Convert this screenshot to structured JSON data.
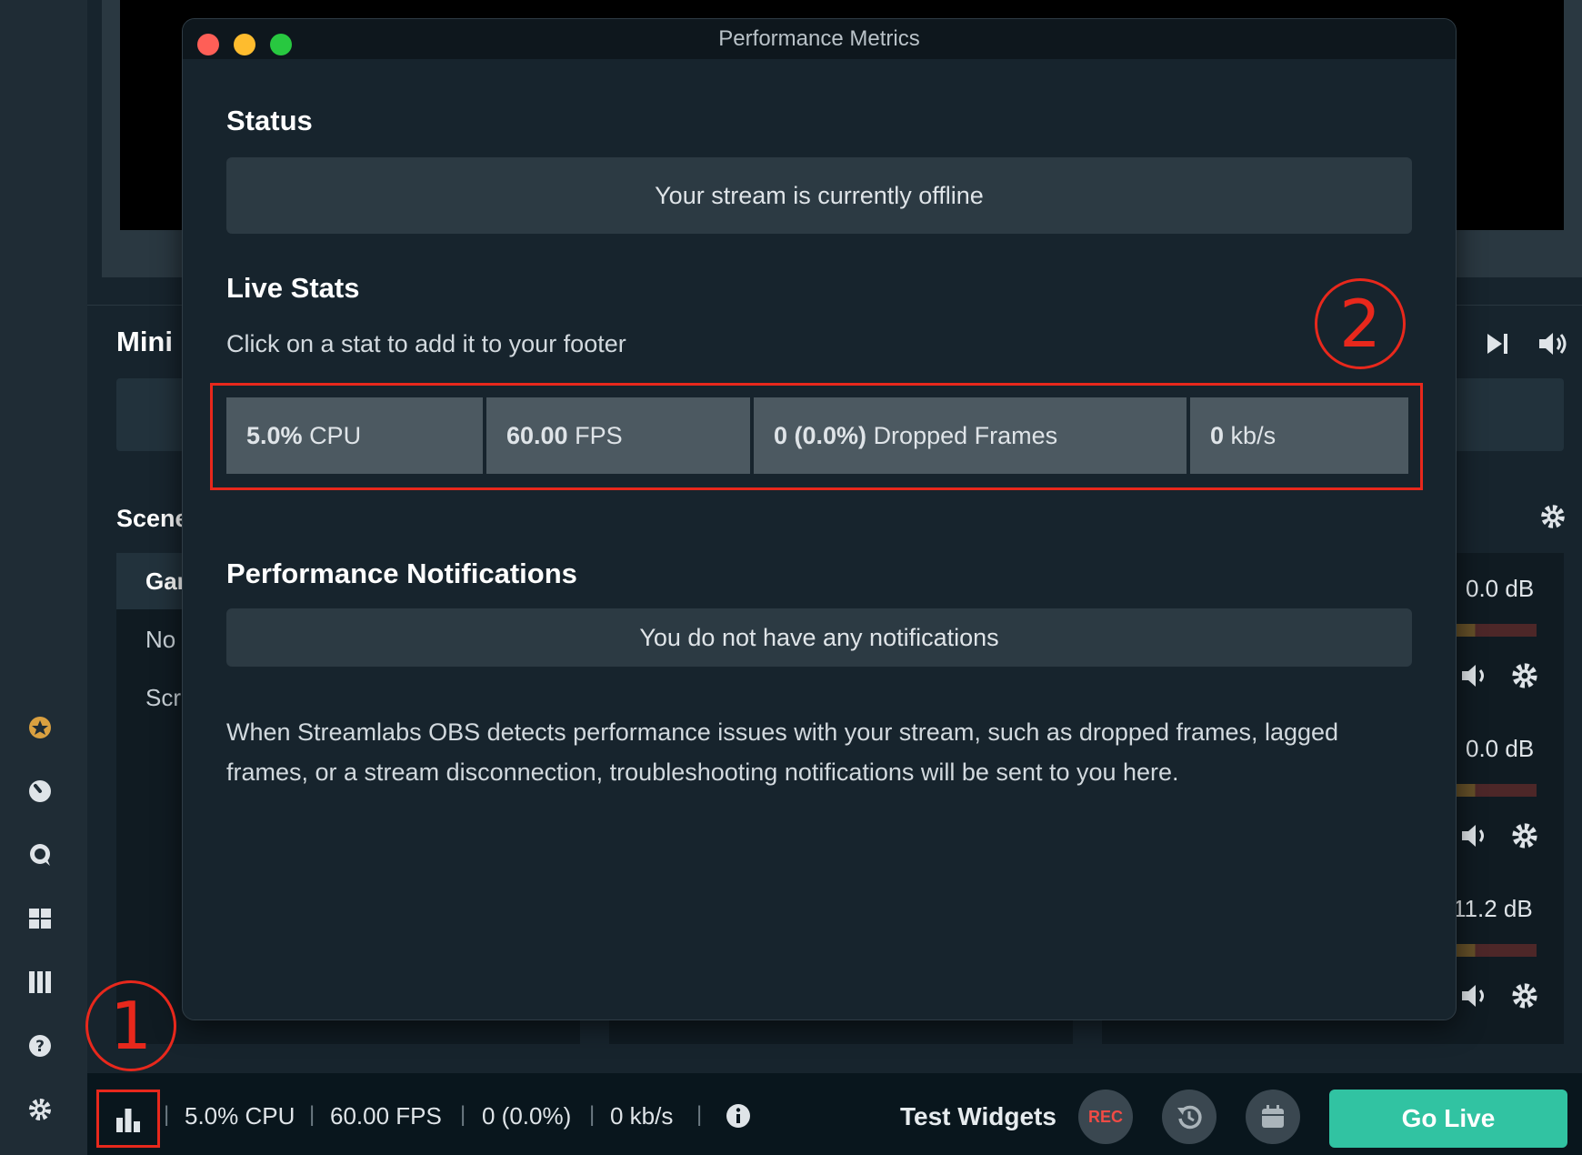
{
  "background": {
    "mini_title": "Mini",
    "scenes_title": "Scene",
    "scene_rows": [
      "Gar",
      "No",
      "Scr"
    ],
    "mixer_db": [
      "0.0 dB",
      "0.0 dB",
      "11.2 dB"
    ]
  },
  "footer": {
    "cpu": "5.0% CPU",
    "fps": "60.00 FPS",
    "dropped": "0 (0.0%)",
    "bitrate": "0 kb/s",
    "separator": "|",
    "test_widgets": "Test Widgets",
    "rec": "REC",
    "go_live": "Go Live"
  },
  "modal": {
    "title": "Performance Metrics",
    "status_title": "Status",
    "status_text": "Your stream is currently offline",
    "live_stats_title": "Live Stats",
    "live_stats_subtitle": "Click on a stat to add it to your footer",
    "stats": [
      {
        "value": "5.0%",
        "label": "CPU"
      },
      {
        "value": "60.00",
        "label": "FPS"
      },
      {
        "value": "0 (0.0%)",
        "label": "Dropped Frames"
      },
      {
        "value": "0",
        "label": "kb/s"
      }
    ],
    "notifications_title": "Performance Notifications",
    "notifications_text": "You do not have any notifications",
    "notifications_desc": "When Streamlabs OBS detects performance issues with your stream, such as dropped frames, lagged frames, or a stream disconnection, troubleshooting notifications will be sent to you here."
  },
  "annotations": {
    "one": "①",
    "two": "②"
  },
  "colors": {
    "accent_green": "#31c3a2",
    "annotation_red": "#e8281c",
    "close": "#fe5f57",
    "minimize": "#febc2e",
    "maximize": "#28c840"
  }
}
